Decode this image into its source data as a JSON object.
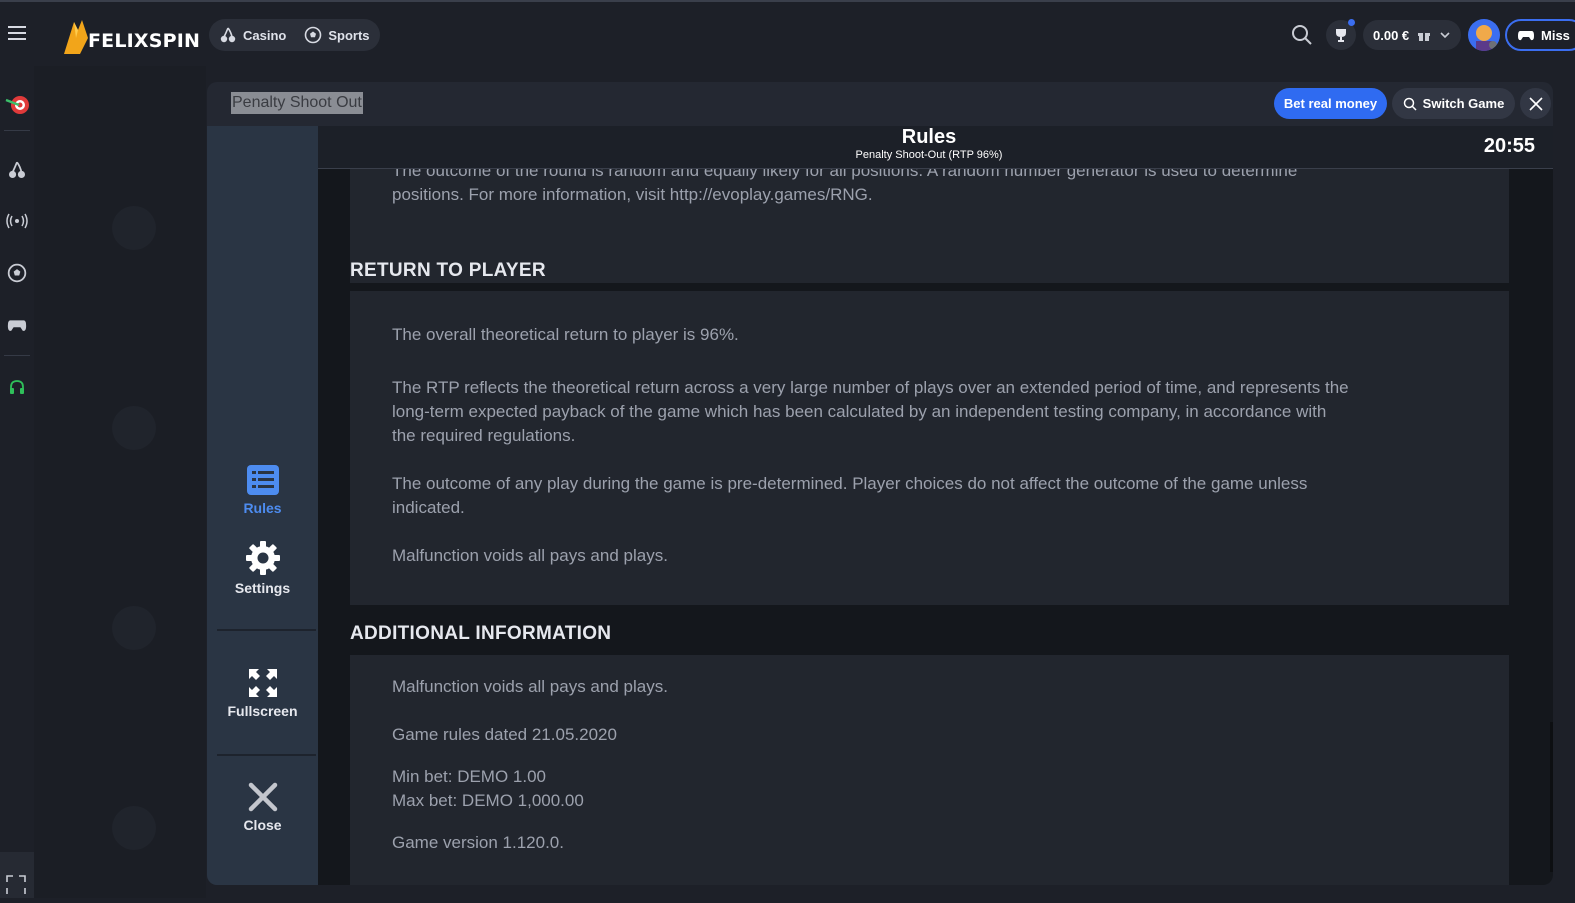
{
  "header": {
    "brand": "FELIXSPIN",
    "nav": [
      {
        "label": "Casino",
        "icon": "cherries-icon"
      },
      {
        "label": "Sports",
        "icon": "soccer-ball-icon"
      }
    ],
    "balance": "0.00 €",
    "missions_label": "Miss"
  },
  "game": {
    "title": "Penalty Shoot Out",
    "bet_real_money": "Bet real money",
    "switch_game": "Switch Game"
  },
  "game_menu": {
    "rules": "Rules",
    "settings": "Settings",
    "fullscreen": "Fullscreen",
    "close": "Close"
  },
  "rules": {
    "title": "Rules",
    "subtitle": "Penalty Shoot-Out (RTP 96%)",
    "clock": "20:55",
    "top_fragment_cut": "The outcome of the round is random and equally likely for all positions. A random number generator is used to determine",
    "top_fragment": "positions. For more information, visit http://evoplay.games/RNG.",
    "rtp_section": {
      "title": "RETURN TO PLAYER",
      "p1": "The overall theoretical return to player is 96%.",
      "p2a": "The RTP reflects the theoretical return across a very large number of plays over an extended period of time, and represents the",
      "p2b": "long-term expected payback of the game which has been calculated by an independent testing company, in accordance with",
      "p2c": "the required regulations.",
      "p3a": "The outcome of any play during the game is pre-determined. Player choices do not affect the outcome of the game unless",
      "p3b": "indicated.",
      "p4": "Malfunction voids all pays and plays."
    },
    "additional_section": {
      "title": "ADDITIONAL INFORMATION",
      "p1": "Malfunction voids all pays and plays.",
      "p2": "Game rules dated 21.05.2020",
      "p3": "Min bet: DEMO 1.00",
      "p4": "Max bet: DEMO 1,000.00",
      "p5": "Game version 1.120.0."
    }
  },
  "colors": {
    "accent": "#2f6bf1",
    "background": "#1d2028",
    "rules_box": "#22262e",
    "rules_text": "#9ca1ad"
  }
}
